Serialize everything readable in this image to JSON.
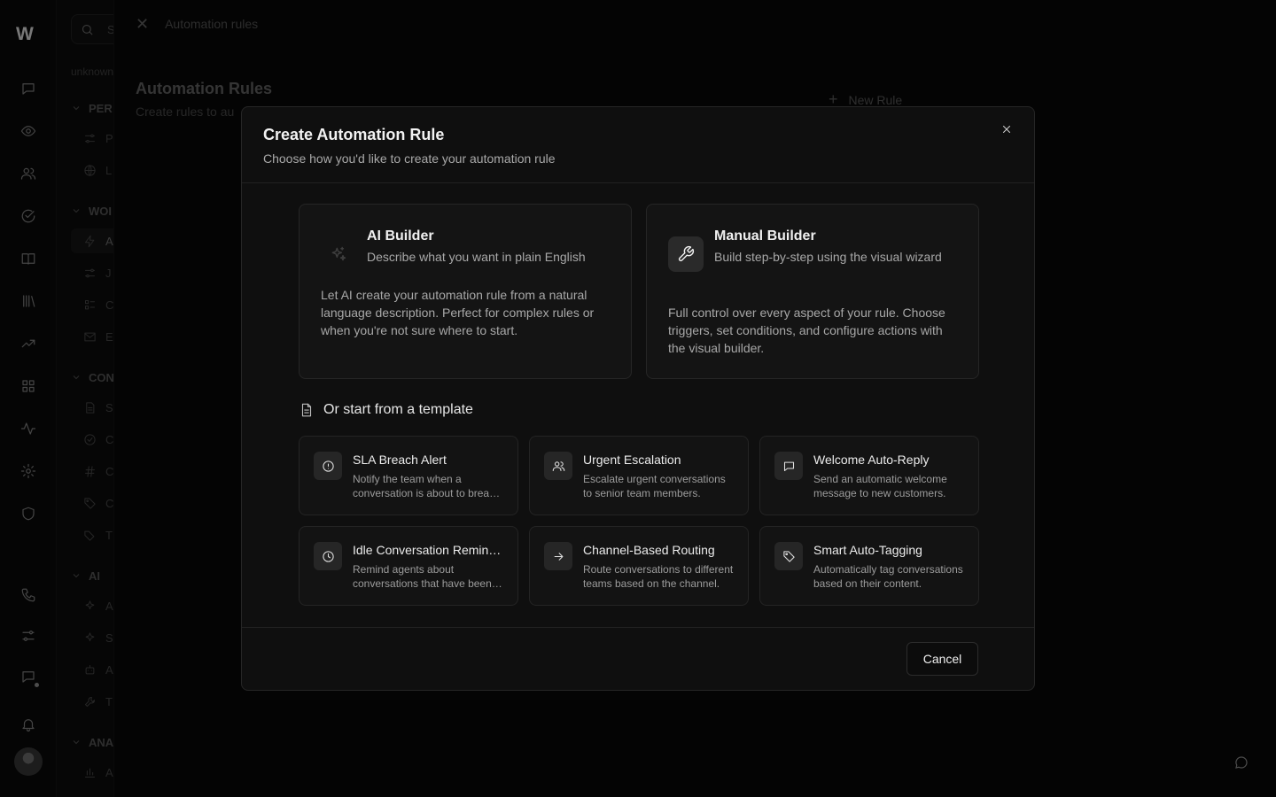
{
  "sidebar": {
    "search_placeholder": "S",
    "workspace": "unknown",
    "sections": [
      {
        "label": "PER"
      },
      {
        "label": "WOI"
      },
      {
        "label": "CON"
      },
      {
        "label": "AI"
      },
      {
        "label": "ANA"
      }
    ],
    "items": [
      {
        "label": "P"
      },
      {
        "label": "L"
      },
      {
        "label": "A"
      },
      {
        "label": "J"
      },
      {
        "label": "C"
      },
      {
        "label": "E"
      },
      {
        "label": "S"
      },
      {
        "label": "C"
      },
      {
        "label": "C"
      },
      {
        "label": "C"
      },
      {
        "label": "T"
      },
      {
        "label": "A"
      },
      {
        "label": "S"
      },
      {
        "label": "A"
      },
      {
        "label": "T"
      },
      {
        "label": "A"
      }
    ]
  },
  "page": {
    "breadcrumb": "Automation rules",
    "title": "Automation Rules",
    "subtitle": "Create rules to au",
    "new_rule_label": "New Rule"
  },
  "modal": {
    "title": "Create Automation Rule",
    "subtitle": "Choose how you'd like to create your automation rule",
    "builders": [
      {
        "title": "AI Builder",
        "subtitle": "Describe what you want in plain English",
        "description": "Let AI create your automation rule from a natural language description. Perfect for complex rules or when you're not sure where to start.",
        "icon": "sparkles-icon"
      },
      {
        "title": "Manual Builder",
        "subtitle": "Build step-by-step using the visual wizard",
        "description": "Full control over every aspect of your rule. Choose triggers, set conditions, and configure actions with the visual builder.",
        "icon": "wrench-icon"
      }
    ],
    "templates_heading": "Or start from a template",
    "templates": [
      {
        "title": "SLA Breach Alert",
        "description": "Notify the team when a conversation is about to breach its SLA.",
        "icon": "alert-circle-icon"
      },
      {
        "title": "Urgent Escalation",
        "description": "Escalate urgent conversations to senior team members.",
        "icon": "users-icon"
      },
      {
        "title": "Welcome Auto-Reply",
        "description": "Send an automatic welcome message to new customers.",
        "icon": "message-square-icon"
      },
      {
        "title": "Idle Conversation Reminder",
        "description": "Remind agents about conversations that have been idle.",
        "icon": "clock-icon"
      },
      {
        "title": "Channel-Based Routing",
        "description": "Route conversations to different teams based on the channel.",
        "icon": "arrow-right-icon"
      },
      {
        "title": "Smart Auto-Tagging",
        "description": "Automatically tag conversations based on their content.",
        "icon": "tag-icon"
      }
    ],
    "cancel_label": "Cancel"
  },
  "colors": {
    "background": "#000000",
    "modal_bg": "#0f0f0f",
    "card_bg": "#141414",
    "border": "#262626",
    "text_primary": "#f0f0f0",
    "text_secondary": "#a8a8a8"
  }
}
